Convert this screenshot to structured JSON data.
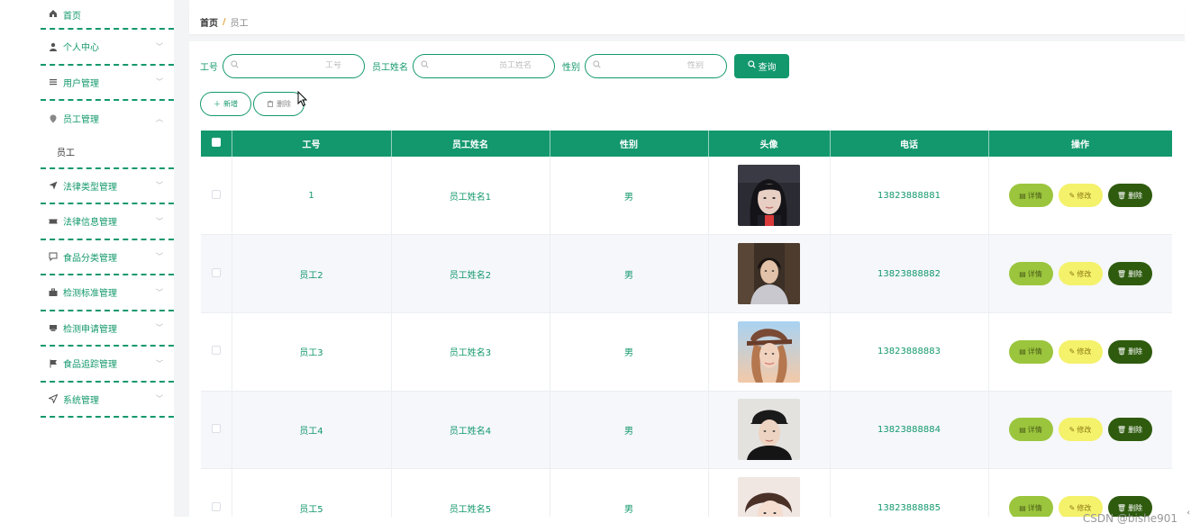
{
  "sidebar": {
    "items": [
      {
        "label": "首页",
        "icon": "home-icon",
        "glyph": "⌂"
      },
      {
        "label": "个人中心",
        "icon": "user-icon",
        "glyph": "●"
      },
      {
        "label": "用户管理",
        "icon": "list-icon",
        "glyph": "☰"
      },
      {
        "label": "员工管理",
        "icon": "pin-icon",
        "glyph": "●",
        "expanded": true,
        "sub": [
          "员工"
        ]
      },
      {
        "label": "法律类型管理",
        "icon": "send-icon",
        "glyph": "➤"
      },
      {
        "label": "法律信息管理",
        "icon": "ticket-icon",
        "glyph": "▬"
      },
      {
        "label": "食品分类管理",
        "icon": "chat-icon",
        "glyph": "▢"
      },
      {
        "label": "检测标准管理",
        "icon": "briefcase-icon",
        "glyph": "▆"
      },
      {
        "label": "检测申请管理",
        "icon": "printer-icon",
        "glyph": "▇"
      },
      {
        "label": "食品追踪管理",
        "icon": "flag-icon",
        "glyph": "⚑"
      },
      {
        "label": "系统管理",
        "icon": "navigation-icon",
        "glyph": "◁"
      }
    ],
    "submenu_label": "员工"
  },
  "breadcrumb": {
    "home": "首页",
    "separator": "/",
    "current": "员工"
  },
  "search": {
    "gonghao_label": "工号",
    "gonghao_placeholder": "工号",
    "name_label": "员工姓名",
    "name_placeholder": "员工姓名",
    "gender_label": "性别",
    "gender_placeholder": "性别",
    "query_label": "查询"
  },
  "toolbar": {
    "add_label": "新增",
    "delete_label": "删除"
  },
  "table": {
    "headers": [
      "工号",
      "员工姓名",
      "性别",
      "头像",
      "电话",
      "操作"
    ],
    "rows": [
      {
        "id": "1",
        "name": "员工姓名1",
        "gender": "男",
        "phone": "13823888881"
      },
      {
        "id": "员工2",
        "name": "员工姓名2",
        "gender": "男",
        "phone": "13823888882"
      },
      {
        "id": "员工3",
        "name": "员工姓名3",
        "gender": "男",
        "phone": "13823888883"
      },
      {
        "id": "员工4",
        "name": "员工姓名4",
        "gender": "男",
        "phone": "13823888884"
      },
      {
        "id": "员工5",
        "name": "员工姓名5",
        "gender": "男",
        "phone": "13823888885"
      }
    ],
    "ops": {
      "detail": "详情",
      "edit": "修改",
      "delete": "删除"
    }
  },
  "watermark": "CSDN @bishe901",
  "colors": {
    "accent": "#13986d",
    "detail_btn": "#9bc53d",
    "edit_btn": "#f4f16b",
    "delete_btn": "#2e5b0e"
  }
}
